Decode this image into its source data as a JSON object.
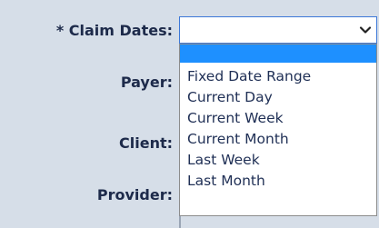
{
  "form": {
    "claim_dates_label": "* Claim Dates:",
    "payer_label": "Payer:",
    "client_label": "Client:",
    "provider_label": "Provider:"
  },
  "claim_dates_select": {
    "value": "",
    "options": [
      "",
      "Fixed Date Range",
      "Current Day",
      "Current Week",
      "Current Month",
      "Last Week",
      "Last Month"
    ]
  },
  "colors": {
    "page_bg": "#d6dee8",
    "label_text": "#1d2a4a",
    "highlight": "#1e90ff",
    "focus_border": "#3c78d8"
  },
  "icons": {
    "select_arrow": "chevron-down-icon"
  }
}
